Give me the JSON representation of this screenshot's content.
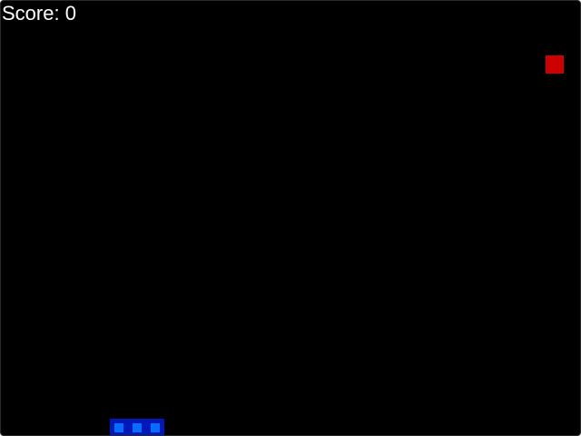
{
  "score": {
    "label": "Score:",
    "value": "0"
  },
  "colors": {
    "background": "#000000",
    "text": "#ffffff",
    "snake_outer": "#0019b8",
    "snake_inner": "#0a6bff",
    "food": "#cc0000"
  },
  "grid": {
    "cell": 20,
    "cols": 32,
    "rows": 24
  },
  "snake": {
    "direction": "right",
    "segments": [
      {
        "col": 6,
        "row": 23
      },
      {
        "col": 7,
        "row": 23
      },
      {
        "col": 8,
        "row": 23
      }
    ]
  },
  "food": {
    "col": 30,
    "row": 3
  }
}
